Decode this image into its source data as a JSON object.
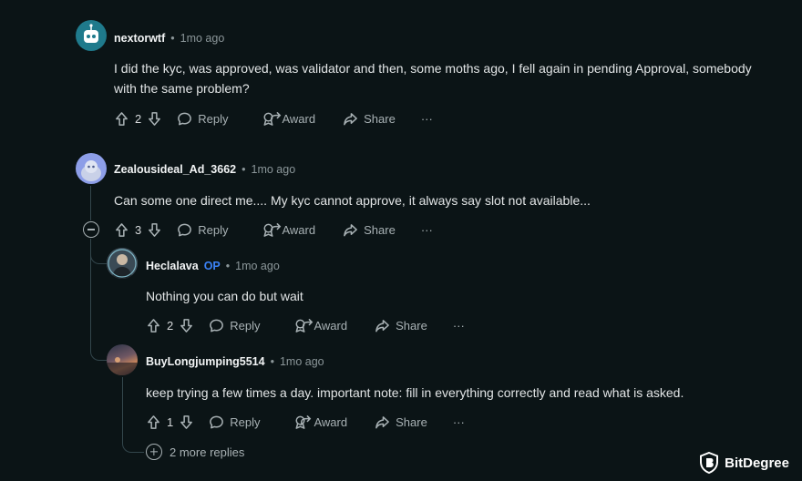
{
  "comments": [
    {
      "username": "nextorwtf",
      "op": "",
      "time": "1mo ago",
      "text": "I did the kyc, was approved, was validator and then, some moths ago, I fell again in pending Approval, somebody with the same problem?",
      "score": "2"
    },
    {
      "username": "Zealousideal_Ad_3662",
      "op": "",
      "time": "1mo ago",
      "text": "Can some one direct me.... My kyc cannot approve, it always say slot not available...",
      "score": "3"
    },
    {
      "username": "Heclalava",
      "op": "OP",
      "time": "1mo ago",
      "text": "Nothing you can do but wait",
      "score": "2"
    },
    {
      "username": "BuyLongjumping5514",
      "op": "",
      "time": "1mo ago",
      "text": "keep trying a few times a day. important note: fill in everything correctly and read what is asked.",
      "score": "1"
    }
  ],
  "actions": {
    "reply": "Reply",
    "award": "Award",
    "share": "Share",
    "more": "···"
  },
  "separator": "•",
  "more_replies": "2 more replies",
  "brand": "BitDegree",
  "icons": {
    "upvote": "arrow-up-outline-icon",
    "downvote": "arrow-down-outline-icon",
    "reply": "speech-bubble-icon",
    "award": "award-ribbon-icon",
    "share": "share-arrow-icon",
    "more": "ellipsis-icon",
    "collapse": "minus-circle-icon",
    "expand": "plus-circle-icon"
  },
  "colors": {
    "background": "#0b1416",
    "text": "#d7dadc",
    "muted": "#8b9699",
    "op_badge": "#3b82f6",
    "thread_line": "#33464c"
  }
}
